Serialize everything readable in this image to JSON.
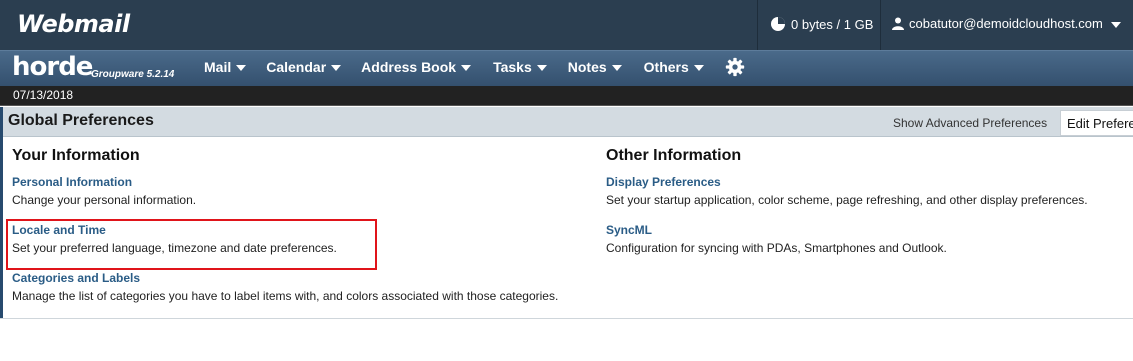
{
  "topbar": {
    "logo": "Webmail",
    "quota": "0 bytes / 1 GB",
    "user": "cobatutor@demoidcloudhost.com"
  },
  "navbar": {
    "logo": "horde",
    "subtitle": "Groupware 5.2.14",
    "menu": [
      "Mail",
      "Calendar",
      "Address Book",
      "Tasks",
      "Notes",
      "Others"
    ]
  },
  "date": "07/13/2018",
  "prefs": {
    "title": "Global Preferences",
    "advanced_link": "Show Advanced Preferences",
    "edit_button": "Edit Preferences"
  },
  "your_info": {
    "heading": "Your Information",
    "items": [
      {
        "label": "Personal Information",
        "desc": "Change your personal information."
      },
      {
        "label": "Locale and Time",
        "desc": "Set your preferred language, timezone and date preferences."
      },
      {
        "label": "Categories and Labels",
        "desc": "Manage the list of categories you have to label items with, and colors associated with those categories."
      }
    ]
  },
  "other_info": {
    "heading": "Other Information",
    "items": [
      {
        "label": "Display Preferences",
        "desc": "Set your startup application, color scheme, page refreshing, and other display preferences."
      },
      {
        "label": "SyncML",
        "desc": "Configuration for syncing with PDAs, Smartphones and Outlook."
      }
    ]
  },
  "icons": {
    "quota": "pie-chart-icon",
    "user": "user-icon",
    "settings": "gear-icon"
  },
  "colors": {
    "topbar": "#2b3e50",
    "link": "#2a5c86",
    "highlight": "#e0141a"
  }
}
